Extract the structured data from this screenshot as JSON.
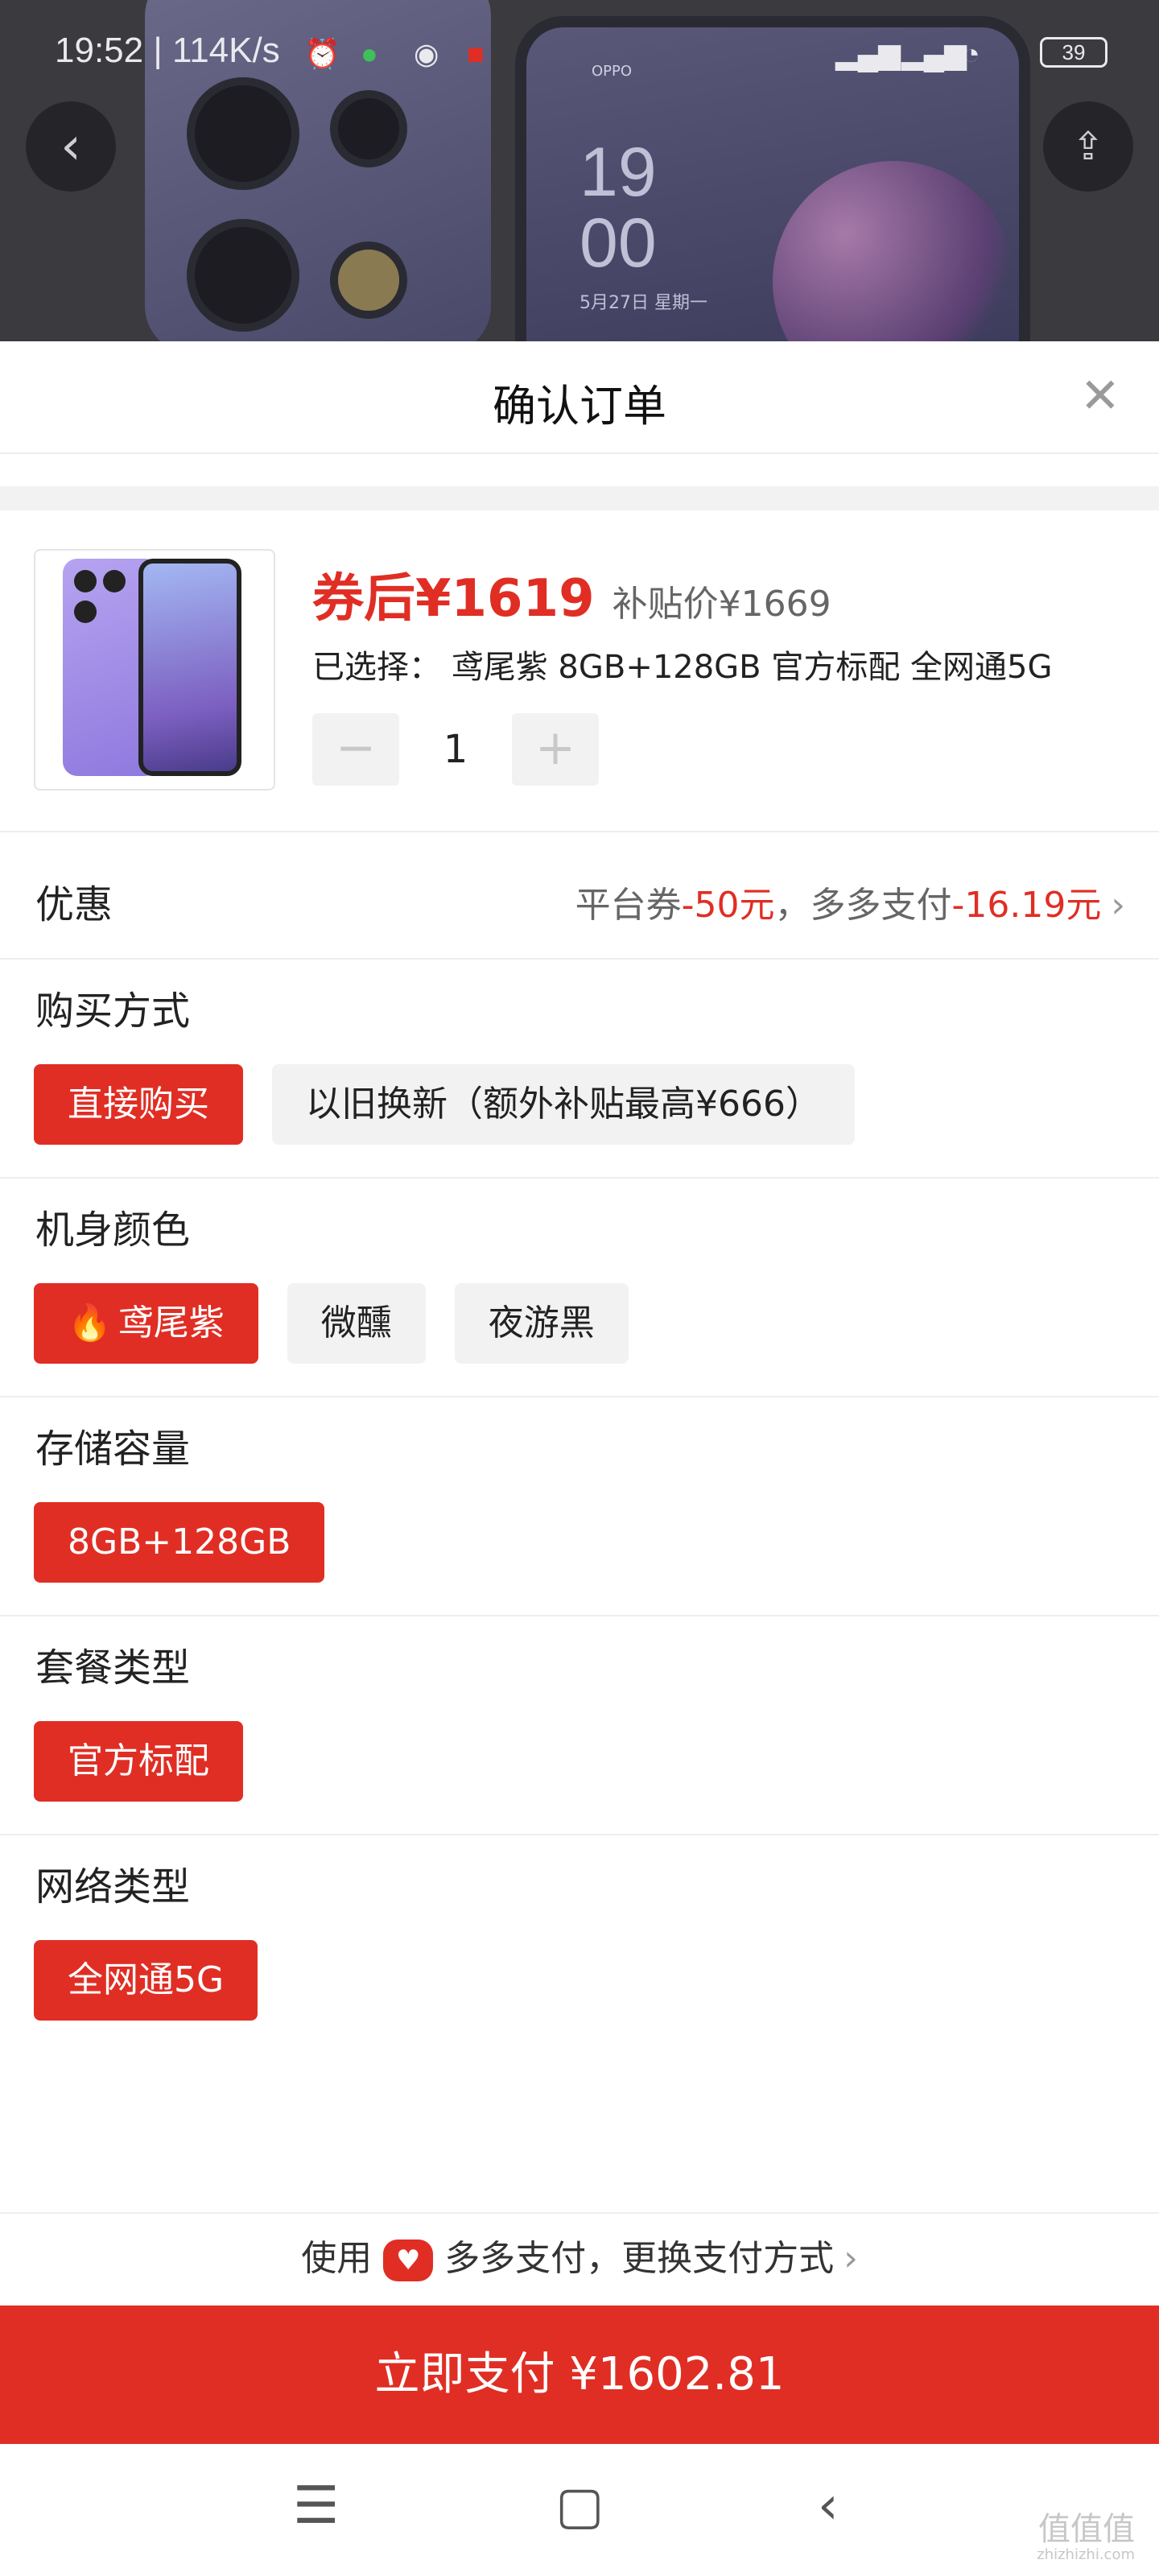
{
  "status_bar": {
    "time_speed": "19:52 | 114K/s",
    "battery": "39"
  },
  "background_product": {
    "brand": "OPPO",
    "clock_hour": "19",
    "clock_min": "00",
    "date": "5月27日 星期一"
  },
  "sheet": {
    "title": "确认订单",
    "product": {
      "price_after_coupon": "券后¥1619",
      "subsidy_price": "补贴价¥1669",
      "selected": "已选择：  鸢尾紫 8GB+128GB 官方标配 全网通5G",
      "quantity": "1",
      "minus": "−",
      "plus": "+"
    },
    "discount": {
      "label": "优惠",
      "platform_coupon_label": "平台券",
      "platform_coupon_value": "-50元",
      "separator": "，",
      "pay_label": "多多支付",
      "pay_value": "-16.19元"
    },
    "purchase_method": {
      "label": "购买方式",
      "options": [
        "直接购买",
        "以旧换新（额外补贴最高¥666）"
      ],
      "selected_index": 0
    },
    "color": {
      "label": "机身颜色",
      "options": [
        "鸢尾紫",
        "微醺",
        "夜游黑"
      ],
      "selected_index": 0
    },
    "storage": {
      "label": "存储容量",
      "options": [
        "8GB+128GB"
      ],
      "selected_index": 0
    },
    "package": {
      "label": "套餐类型",
      "options": [
        "官方标配"
      ],
      "selected_index": 0
    },
    "network": {
      "label": "网络类型",
      "options": [
        "全网通5G"
      ],
      "selected_index": 0
    },
    "payment": {
      "prefix": "使用",
      "text": "多多支付，更换支付方式"
    },
    "pay_button": "立即支付 ¥1602.81"
  },
  "watermark": {
    "text": "值值值",
    "sub": "zhizhizhi.com"
  },
  "colors": {
    "accent": "#e02e24",
    "option_bg": "#f2f2f2"
  }
}
